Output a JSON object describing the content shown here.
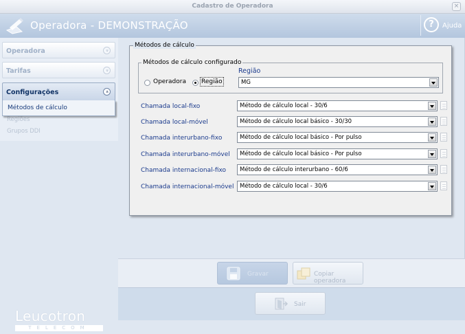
{
  "window": {
    "title": "Cadastro de Operadora",
    "close_glyph": "×"
  },
  "header": {
    "title": "Operadora - DEMONSTRAÇÃO",
    "help_label": "Ajuda",
    "help_glyph": "?",
    "logo_icon": "pencil-edit-icon"
  },
  "sidebar": {
    "sections": [
      {
        "label": "Operadora",
        "state": "collapsed"
      },
      {
        "label": "Tarifas",
        "state": "collapsed"
      },
      {
        "label": "Configurações",
        "state": "expanded"
      }
    ],
    "expand_glyph": "»",
    "collapse_glyph": "«",
    "popup_item": "Métodos de cálculo",
    "faded_items": [
      "Regiões",
      "Grupos DDI"
    ]
  },
  "brand": {
    "name": "Leucotron",
    "sub": "TELECOM"
  },
  "metodos": {
    "group_title": "Métodos de cálculo",
    "config_group_title": "Métodos de cálculo configurado",
    "radio_operadora": "Operadora",
    "radio_regiao": "Região",
    "selected_radio": "Região",
    "regiao_label": "Região",
    "regiao_value": "MG",
    "rows": [
      {
        "label": "Chamada local-fixo",
        "value": "Método de cálculo local - 30/6"
      },
      {
        "label": "Chamada local-móvel",
        "value": "Método de cálculo local básico - 30/30"
      },
      {
        "label": "Chamada interurbano-fixo",
        "value": "Método de cálculo local básico - Por pulso"
      },
      {
        "label": "Chamada interurbano-móvel",
        "value": "Método de cálculo local básico - Por pulso"
      },
      {
        "label": "Chamada internacional-fixo",
        "value": "Método de cálculo interurbano - 60/6"
      },
      {
        "label": "Chamada internacional-móvel",
        "value": "Método de cálculo local - 30/6"
      }
    ]
  },
  "buttons": {
    "gravar": "Gravar",
    "copiar": "Copiar operadora",
    "sair": "Sair"
  },
  "colors": {
    "header": "#b3c6de",
    "label_blue": "#1a3a8c",
    "sidebar": "#dfe7f1"
  }
}
